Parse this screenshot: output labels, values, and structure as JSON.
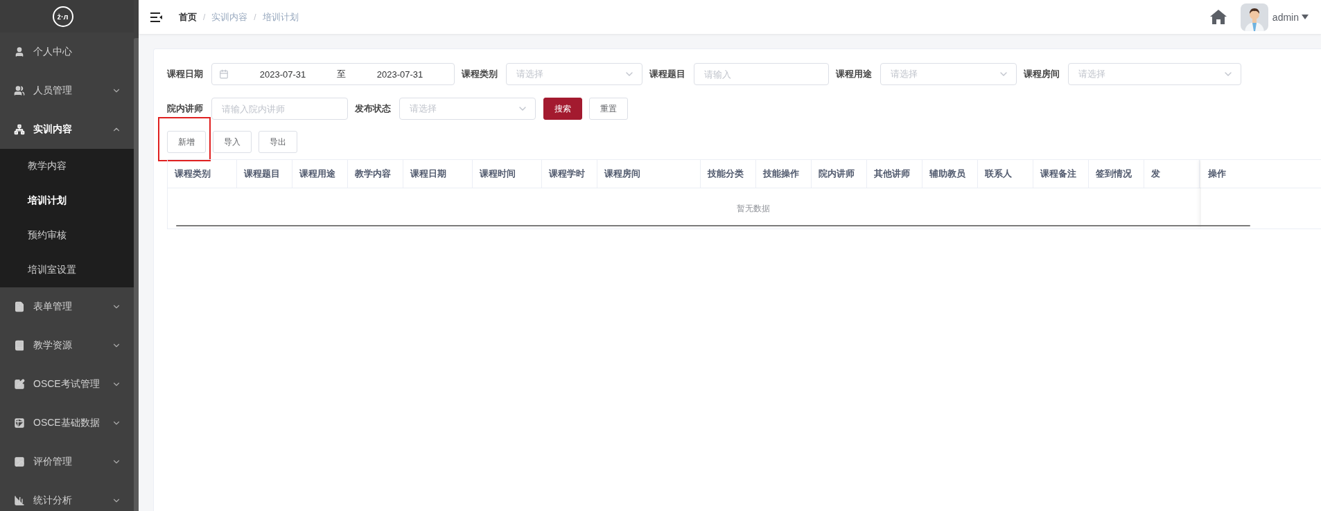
{
  "logo": "ż·л",
  "sidebar": {
    "items": [
      {
        "kind": "link",
        "label": "个人中心"
      },
      {
        "kind": "group",
        "label": "人员管理",
        "expanded": false
      },
      {
        "kind": "group",
        "label": "实训内容",
        "expanded": true,
        "children": [
          {
            "label": "教学内容",
            "selected": false
          },
          {
            "label": "培训计划",
            "selected": true
          },
          {
            "label": "预约审核",
            "selected": false
          },
          {
            "label": "培训室设置",
            "selected": false
          }
        ]
      },
      {
        "kind": "group",
        "label": "表单管理",
        "expanded": false
      },
      {
        "kind": "group",
        "label": "教学资源",
        "expanded": false
      },
      {
        "kind": "group",
        "label": "OSCE考试管理",
        "expanded": false
      },
      {
        "kind": "group",
        "label": "OSCE基础数据",
        "expanded": false
      },
      {
        "kind": "group",
        "label": "评价管理",
        "expanded": false
      },
      {
        "kind": "group",
        "label": "统计分析",
        "expanded": false
      }
    ]
  },
  "header": {
    "breadcrumb": [
      "首页",
      "实训内容",
      "培训计划"
    ],
    "breadcrumb_separator": "/",
    "user": "admin"
  },
  "filters": {
    "items": [
      {
        "kind": "daterange",
        "label": "课程日期",
        "start": "2023-07-31",
        "separator": "至",
        "end": "2023-07-31"
      },
      {
        "kind": "select",
        "label": "课程类别",
        "placeholder": "请选择"
      },
      {
        "kind": "input",
        "label": "课程题目",
        "placeholder": "请输入"
      },
      {
        "kind": "select",
        "label": "课程用途",
        "placeholder": "请选择"
      },
      {
        "kind": "select",
        "label": "课程房间",
        "placeholder": "请选择"
      },
      {
        "kind": "input",
        "label": "院内讲师",
        "placeholder": "请输入院内讲师"
      },
      {
        "kind": "select",
        "label": "发布状态",
        "placeholder": "请选择"
      }
    ],
    "actions": [
      {
        "kind": "primary",
        "label": "搜索"
      },
      {
        "kind": "default",
        "label": "重置"
      }
    ]
  },
  "toolbar": [
    {
      "label": "新增",
      "highlighted": true
    },
    {
      "label": "导入",
      "highlighted": false
    },
    {
      "label": "导出",
      "highlighted": false
    }
  ],
  "table": {
    "columns": [
      "课程类别",
      "课程题目",
      "课程用途",
      "教学内容",
      "课程日期",
      "课程时间",
      "课程学时",
      "课程房间",
      "技能分类",
      "技能操作",
      "院内讲师",
      "其他讲师",
      "辅助教员",
      "联系人",
      "课程备注",
      "签到情况",
      "发"
    ],
    "fixed_column": "操作",
    "empty_text": "暂无数据"
  }
}
